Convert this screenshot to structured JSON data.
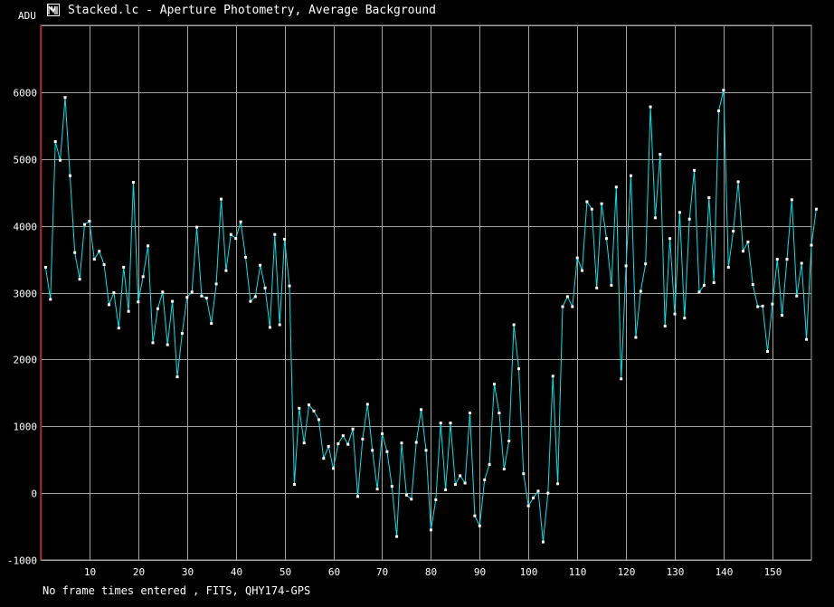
{
  "window": {
    "title": "Stacked.lc - Aperture Photometry, Average Background",
    "icon": "app-icon"
  },
  "footer": {
    "status": "No frame times entered , FITS, QHY174-GPS"
  },
  "colors": {
    "background": "#000000",
    "grid": "#a0a0a0",
    "series": "#00e6e6",
    "marker_line": "#d02020"
  },
  "chart_data": {
    "type": "line",
    "title": "Stacked.lc - Aperture Photometry, Average Background",
    "xlabel": "",
    "ylabel": "ADU",
    "xlim": [
      0,
      158
    ],
    "ylim": [
      -1000,
      7000
    ],
    "xticks": [
      10,
      20,
      30,
      40,
      50,
      60,
      70,
      80,
      90,
      100,
      110,
      120,
      130,
      140,
      150
    ],
    "yticks": [
      -1000,
      0,
      1000,
      2000,
      3000,
      4000,
      5000,
      6000
    ],
    "grid": true,
    "legend": "none",
    "series": [
      {
        "values": [
          3380,
          2900,
          5260,
          4980,
          5920,
          4750,
          3600,
          3200,
          4020,
          4070,
          3500,
          3620,
          3420,
          2820,
          3000,
          2470,
          3380,
          2720,
          4650,
          2860,
          3240,
          3700,
          2250,
          2760,
          3010,
          2220,
          2870,
          1740,
          2390,
          2930,
          3010,
          3980,
          2950,
          2920,
          2540,
          3130,
          4400,
          3330,
          3870,
          3810,
          4060,
          3530,
          2870,
          2940,
          3410,
          3070,
          2480,
          3870,
          2520,
          3800,
          3100,
          130,
          1270,
          750,
          1320,
          1230,
          1100,
          520,
          700,
          370,
          740,
          860,
          730,
          960,
          -50,
          810,
          1330,
          640,
          60,
          890,
          620,
          100,
          -650,
          750,
          -30,
          -90,
          760,
          1250,
          640,
          -550,
          -100,
          1050,
          50,
          1050,
          130,
          260,
          150,
          1200,
          -340,
          -490,
          200,
          430,
          1630,
          1200,
          360,
          780,
          2520,
          1860,
          290,
          -190,
          -70,
          30,
          -730,
          0,
          1750,
          140,
          2790,
          2940,
          2790,
          3520,
          3330,
          4360,
          4250,
          3070,
          4330,
          3810,
          3110,
          4580,
          1710,
          3400,
          4750,
          2330,
          3020,
          3430,
          5780,
          4120,
          5070,
          2500,
          3810,
          2680,
          4200,
          2620,
          4100,
          4830,
          3010,
          3110,
          4420,
          3150,
          5720,
          6030,
          3380,
          3920,
          4660,
          3620,
          3760,
          3120,
          2790,
          2800,
          2120,
          2830,
          3500,
          2660,
          3500,
          4390,
          2950,
          3440,
          2300,
          3710,
          4250
        ]
      }
    ]
  }
}
